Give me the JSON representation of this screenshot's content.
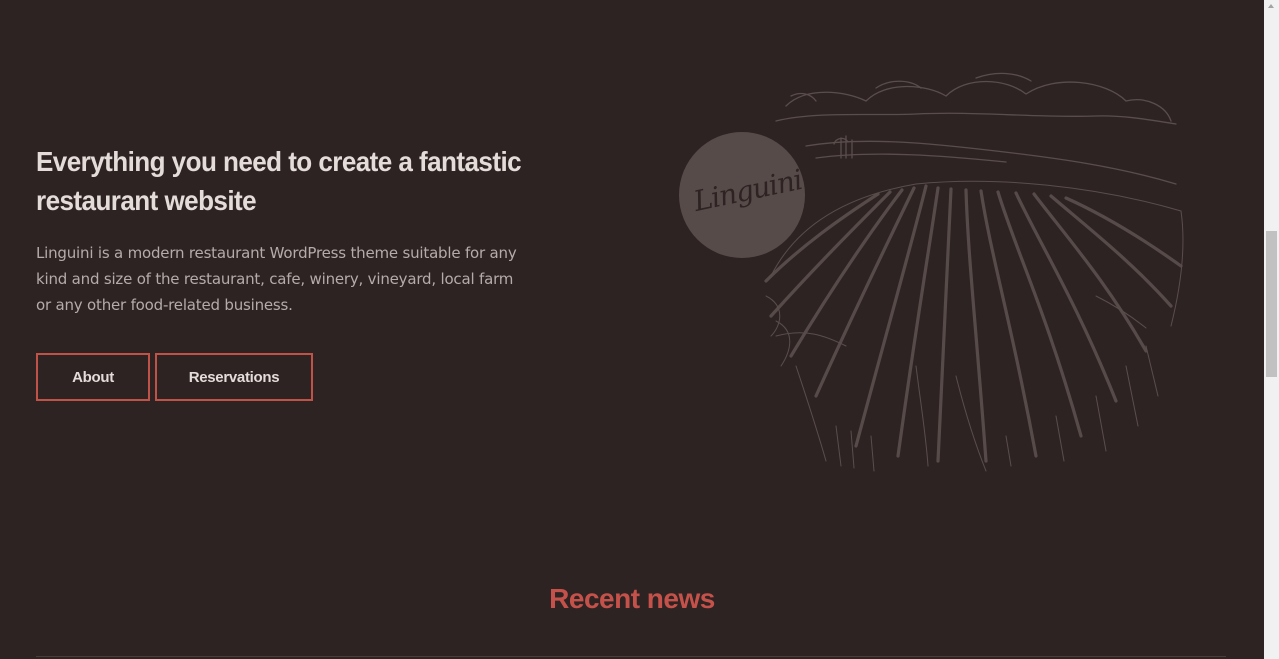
{
  "hero": {
    "title": "Everything you need to create a fantastic restaurant website",
    "description": "Linguini is a modern restaurant WordPress theme suitable for any kind and size of the restaurant, cafe, winery, vineyard, local farm or any other food-related business.",
    "buttons": [
      {
        "label": "About"
      },
      {
        "label": "Reservations"
      }
    ],
    "logo_text": "Linguini",
    "illustration": "vineyard-sketch"
  },
  "recent_news": {
    "title": "Recent news"
  },
  "colors": {
    "background": "#2e2323",
    "accent": "#c5524a",
    "heading": "#e3dcd9",
    "body_text": "#b4abaa",
    "sketch": "#5a4e4d"
  }
}
